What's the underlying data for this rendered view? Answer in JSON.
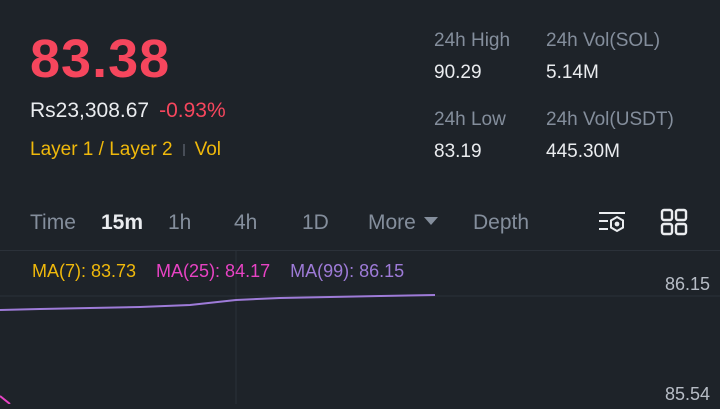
{
  "price": "83.38",
  "fiat_value": "Rs23,308.67",
  "change_pct": "-0.93%",
  "tags": {
    "category": "Layer 1 / Layer 2",
    "vol": "Vol"
  },
  "stats": {
    "high": {
      "label": "24h High",
      "value": "90.29"
    },
    "vol_base": {
      "label": "24h Vol(SOL)",
      "value": "5.14M"
    },
    "low": {
      "label": "24h Low",
      "value": "83.19"
    },
    "vol_quote": {
      "label": "24h Vol(USDT)",
      "value": "445.30M"
    }
  },
  "tabs": {
    "time": "Time",
    "m15": "15m",
    "h1": "1h",
    "h4": "4h",
    "d1": "1D",
    "more": "More",
    "depth": "Depth"
  },
  "active_tab": "15m",
  "icons": {
    "indicator": "chart-settings-icon",
    "layout": "grid-layout-icon"
  },
  "ma": {
    "ma7": "MA(7): 83.73",
    "ma25": "MA(25): 84.17",
    "ma99": "MA(99): 86.15"
  },
  "axis": {
    "top_price": "86.15",
    "bottom_price": "85.54"
  },
  "colors": {
    "down": "#f6465d",
    "accent": "#f0b90b",
    "ma25": "#e843c4",
    "ma99": "#9e7bd8",
    "background": "#1e2329"
  }
}
